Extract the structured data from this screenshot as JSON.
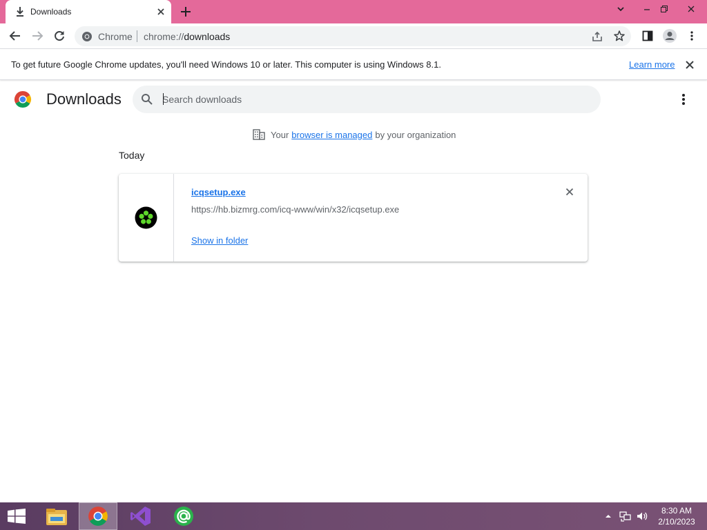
{
  "browser": {
    "tab": {
      "title": "Downloads"
    },
    "omnibox": {
      "site_label": "Chrome",
      "url_scheme": "chrome://",
      "url_host": "downloads"
    },
    "accent_color": "#e4699a"
  },
  "infobar": {
    "message": "To get future Google Chrome updates, you'll need Windows 10 or later. This computer is using Windows 8.1.",
    "link_label": "Learn more"
  },
  "downloads": {
    "title": "Downloads",
    "search_placeholder": "Search downloads",
    "managed_prefix": "Your",
    "managed_link": "browser is managed",
    "managed_suffix": "by your organization",
    "date_header": "Today",
    "items": [
      {
        "file_name": "icqsetup.exe",
        "url": "https://hb.bizmrg.com/icq-www/win/x32/icqsetup.exe",
        "action_label": "Show in folder",
        "icon": "icq-flower-icon"
      }
    ]
  },
  "taskbar": {
    "apps": [
      "file-explorer-icon",
      "chrome-icon",
      "visual-studio-icon",
      "mail-at-icon"
    ],
    "active_app": "chrome-icon",
    "clock_time": "8:30 AM",
    "clock_date": "2/10/2023"
  }
}
